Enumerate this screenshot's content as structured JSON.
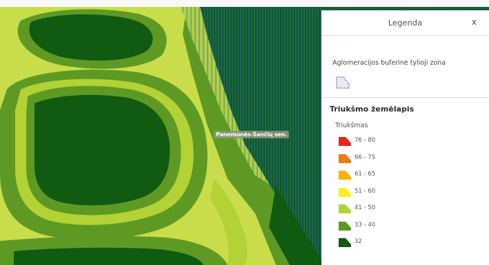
{
  "legend": {
    "title": "Legenda",
    "close_label": "x",
    "buffer_zone_label": "Aglomeracijos buferinė tylioji zona",
    "buffer_zone_color": "#9a86c4",
    "layer_title": "Triukšmo žemėlapis",
    "field_title": "Triukšmas",
    "classes": [
      {
        "label": "76 - 80",
        "color": "#e8261a"
      },
      {
        "label": "66 - 75",
        "color": "#f07a10"
      },
      {
        "label": "61 - 65",
        "color": "#f8b10f"
      },
      {
        "label": "51 - 60",
        "color": "#fbef1c"
      },
      {
        "label": "41 - 50",
        "color": "#b2d235"
      },
      {
        "label": "33 - 40",
        "color": "#5e9a23"
      },
      {
        "label": "32",
        "color": "#105a12"
      }
    ]
  },
  "map": {
    "place_label": "Panemunės-Šančių sen.",
    "zone_colors": {
      "lightest": "#d6e558",
      "light": "#b2d235",
      "mid": "#5e9a23",
      "dark": "#105a12"
    },
    "hatch_color": "#5b82b8"
  }
}
